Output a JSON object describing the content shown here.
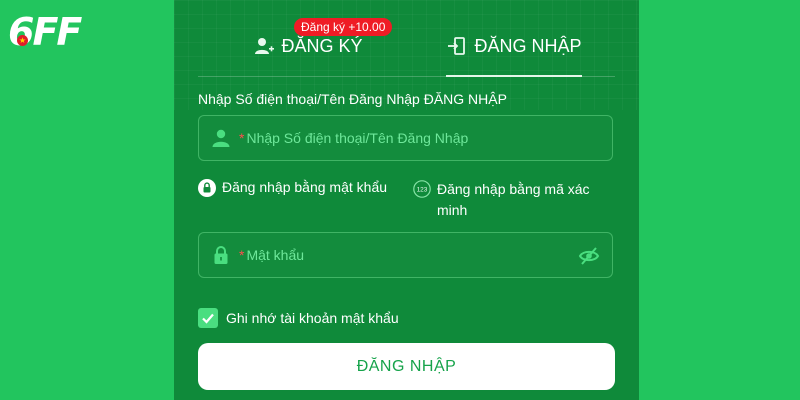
{
  "logo": {
    "text": "6FF",
    "flag_star": "★"
  },
  "tabs": {
    "register": {
      "label": "ĐĂNG KÝ",
      "badge": "Đăng ký +10.00"
    },
    "login": {
      "label": "ĐĂNG NHẬP",
      "active": true
    }
  },
  "form": {
    "label": "Nhập Số điện thoại/Tên Đăng Nhập ĐĂNG NHẬP",
    "username": {
      "required_mark": "*",
      "placeholder": "Nhập Số điện thoại/Tên Đăng Nhập"
    },
    "options": {
      "by_password": "Đăng nhập bằng mật khẩu",
      "by_code_icon_text": "123",
      "by_code": "Đăng nhập bằng mã xác minh"
    },
    "password": {
      "required_mark": "*",
      "placeholder": "Mật khẩu"
    },
    "remember": {
      "label": "Ghi nhớ tài khoản mật khẩu",
      "checked": true
    },
    "submit_label": "ĐĂNG NHẬP"
  },
  "colors": {
    "background": "#22c55e",
    "panel": "#0f8a3a",
    "accent": "#4ade80",
    "placeholder": "#6ee79a",
    "badge": "#ef1c25",
    "button_text": "#16a34a"
  }
}
